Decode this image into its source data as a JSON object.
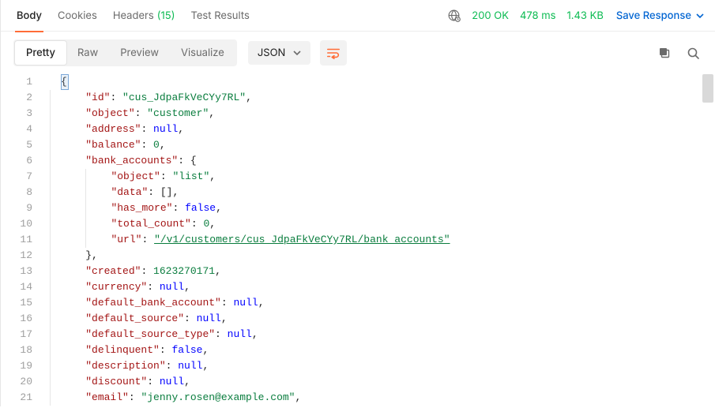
{
  "tabs": {
    "body": "Body",
    "cookies": "Cookies",
    "headers_label": "Headers",
    "headers_count": "(15)",
    "test_results": "Test Results"
  },
  "status": {
    "code": "200 OK",
    "time": "478 ms",
    "size": "1.43 KB"
  },
  "save_label": "Save Response",
  "viewmode": {
    "pretty": "Pretty",
    "raw": "Raw",
    "preview": "Preview",
    "visualize": "Visualize"
  },
  "format_label": "JSON",
  "code": {
    "l1": "{",
    "l2_k": "\"id\"",
    "l2_v": "\"cus_JdpaFkVeCYy7RL\"",
    "l3_k": "\"object\"",
    "l3_v": "\"customer\"",
    "l4_k": "\"address\"",
    "l4_v": "null",
    "l5_k": "\"balance\"",
    "l5_v": "0",
    "l6_k": "\"bank_accounts\"",
    "l6_v": "{",
    "l7_k": "\"object\"",
    "l7_v": "\"list\"",
    "l8_k": "\"data\"",
    "l8_v": "[]",
    "l9_k": "\"has_more\"",
    "l9_v": "false",
    "l10_k": "\"total_count\"",
    "l10_v": "0",
    "l11_k": "\"url\"",
    "l11_v": "\"/v1/customers/cus_JdpaFkVeCYy7RL/bank_accounts\"",
    "l12": "},",
    "l13_k": "\"created\"",
    "l13_v": "1623270171",
    "l14_k": "\"currency\"",
    "l14_v": "null",
    "l15_k": "\"default_bank_account\"",
    "l15_v": "null",
    "l16_k": "\"default_source\"",
    "l16_v": "null",
    "l17_k": "\"default_source_type\"",
    "l17_v": "null",
    "l18_k": "\"delinquent\"",
    "l18_v": "false",
    "l19_k": "\"description\"",
    "l19_v": "null",
    "l20_k": "\"discount\"",
    "l20_v": "null",
    "l21_k": "\"email\"",
    "l21_v": "\"jenny.rosen@example.com\""
  },
  "lines": [
    "1",
    "2",
    "3",
    "4",
    "5",
    "6",
    "7",
    "8",
    "9",
    "10",
    "11",
    "12",
    "13",
    "14",
    "15",
    "16",
    "17",
    "18",
    "19",
    "20",
    "21"
  ]
}
